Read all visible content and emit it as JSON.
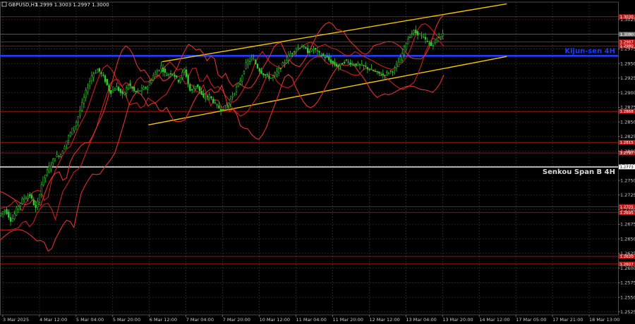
{
  "header": {
    "symbol": "GBPUSD,H1",
    "ohlc": "1.2999 1.3003 1.2997 1.3000"
  },
  "chart_data": {
    "type": "candlestick",
    "y_range": [
      1.252,
      1.3055
    ],
    "y_ticks": [
      "1.3025",
      "1.3000",
      "1.2975",
      "1.2950",
      "1.2925",
      "1.2900",
      "1.2875",
      "1.2850",
      "1.2825",
      "1.2800",
      "1.2775",
      "1.2750",
      "1.2725",
      "1.2700",
      "1.2675",
      "1.2650",
      "1.2625",
      "1.2600",
      "1.2575",
      "1.2550",
      "1.2525"
    ],
    "x_ticks": [
      "3 Mar 2025",
      "4 Mar 12:00",
      "5 Mar 04:00",
      "5 Mar 20:00",
      "6 Mar 12:00",
      "7 Mar 04:00",
      "7 Mar 20:00",
      "10 Mar 12:00",
      "11 Mar 04:00",
      "11 Mar 20:00",
      "12 Mar 12:00",
      "13 Mar 04:00",
      "13 Mar 20:00",
      "14 Mar 12:00",
      "17 Mar 05:00",
      "17 Mar 21:00",
      "18 Mar 13:00"
    ],
    "horizontal_levels": [
      {
        "price": 1.303,
        "label": "1.3030",
        "color": "#c01818"
      },
      {
        "price": 1.3,
        "label": "1.3000",
        "color": "#6a6a6a"
      },
      {
        "price": 1.2987,
        "label": "1.2987",
        "color": "#c01818"
      },
      {
        "price": 1.298,
        "label": "1.2980",
        "color": "#c01818"
      },
      {
        "price": 1.2868,
        "label": "1.2868",
        "color": "#c01818"
      },
      {
        "price": 1.2815,
        "label": "1.2815",
        "color": "#c01818"
      },
      {
        "price": 1.2797,
        "label": "1.2797",
        "color": "#c01818"
      },
      {
        "price": 1.2705,
        "label": "1.2705",
        "color": "#c01818"
      },
      {
        "price": 1.2695,
        "label": "1.2695",
        "color": "#c01818"
      },
      {
        "price": 1.262,
        "label": "1.2620",
        "color": "#c01818"
      },
      {
        "price": 1.2607,
        "label": "1.2607",
        "color": "#c01818"
      }
    ],
    "kijun": {
      "price": 1.2963,
      "label": "Kijun-sen 4H",
      "color": "#1e3cff"
    },
    "senkou": {
      "price": 1.2773,
      "label": "Senkou Span B 4H",
      "tag": "1.2773",
      "color": "#d8d8d8"
    },
    "channel": {
      "upper": [
        [
          1.2953,
          0.262
        ],
        [
          1.3052,
          0.82
        ]
      ],
      "lower": [
        [
          1.2845,
          0.24
        ],
        [
          1.2962,
          0.82
        ]
      ],
      "color": "#f5c400"
    },
    "price_path": [
      [
        0.0,
        1.269
      ],
      [
        0.01,
        1.27
      ],
      [
        0.02,
        1.268
      ],
      [
        0.03,
        1.2705
      ],
      [
        0.04,
        1.272
      ],
      [
        0.05,
        1.2725
      ],
      [
        0.06,
        1.27
      ],
      [
        0.07,
        1.275
      ],
      [
        0.08,
        1.277
      ],
      [
        0.09,
        1.279
      ],
      [
        0.1,
        1.2795
      ],
      [
        0.11,
        1.282
      ],
      [
        0.125,
        1.285
      ],
      [
        0.14,
        1.29
      ],
      [
        0.15,
        1.293
      ],
      [
        0.16,
        1.294
      ],
      [
        0.17,
        1.2925
      ],
      [
        0.18,
        1.29
      ],
      [
        0.19,
        1.291
      ],
      [
        0.2,
        1.2895
      ],
      [
        0.21,
        1.2915
      ],
      [
        0.22,
        1.29
      ],
      [
        0.23,
        1.2905
      ],
      [
        0.24,
        1.291
      ],
      [
        0.25,
        1.293
      ],
      [
        0.262,
        1.2945
      ],
      [
        0.27,
        1.293
      ],
      [
        0.28,
        1.2935
      ],
      [
        0.29,
        1.292
      ],
      [
        0.3,
        1.294
      ],
      [
        0.31,
        1.29
      ],
      [
        0.32,
        1.2915
      ],
      [
        0.33,
        1.289
      ],
      [
        0.34,
        1.2895
      ],
      [
        0.35,
        1.288
      ],
      [
        0.36,
        1.287
      ],
      [
        0.37,
        1.288
      ],
      [
        0.38,
        1.29
      ],
      [
        0.39,
        1.292
      ],
      [
        0.4,
        1.295
      ],
      [
        0.41,
        1.296
      ],
      [
        0.42,
        1.294
      ],
      [
        0.43,
        1.293
      ],
      [
        0.44,
        1.2925
      ],
      [
        0.45,
        1.2935
      ],
      [
        0.46,
        1.295
      ],
      [
        0.47,
        1.2965
      ],
      [
        0.48,
        1.2975
      ],
      [
        0.49,
        1.298
      ],
      [
        0.5,
        1.297
      ],
      [
        0.51,
        1.2975
      ],
      [
        0.52,
        1.2965
      ],
      [
        0.53,
        1.296
      ],
      [
        0.54,
        1.295
      ],
      [
        0.55,
        1.2945
      ],
      [
        0.56,
        1.2955
      ],
      [
        0.57,
        1.295
      ],
      [
        0.58,
        1.2948
      ],
      [
        0.59,
        1.2945
      ],
      [
        0.6,
        1.294
      ],
      [
        0.61,
        1.2935
      ],
      [
        0.62,
        1.293
      ],
      [
        0.63,
        1.2935
      ],
      [
        0.64,
        1.294
      ],
      [
        0.65,
        1.296
      ],
      [
        0.66,
        1.299
      ],
      [
        0.67,
        1.3005
      ],
      [
        0.68,
        1.3
      ],
      [
        0.69,
        1.299
      ],
      [
        0.7,
        1.298
      ],
      [
        0.71,
        1.2995
      ],
      [
        0.718,
        1.3
      ]
    ],
    "envelopes": [
      {
        "color": "#cc1e1e",
        "offset": 0.0012
      },
      {
        "color": "#cc1e1e",
        "offset": -0.0018
      },
      {
        "color": "#e03030",
        "offset": 0.003
      },
      {
        "color": "#e03030",
        "offset": -0.004
      }
    ]
  }
}
